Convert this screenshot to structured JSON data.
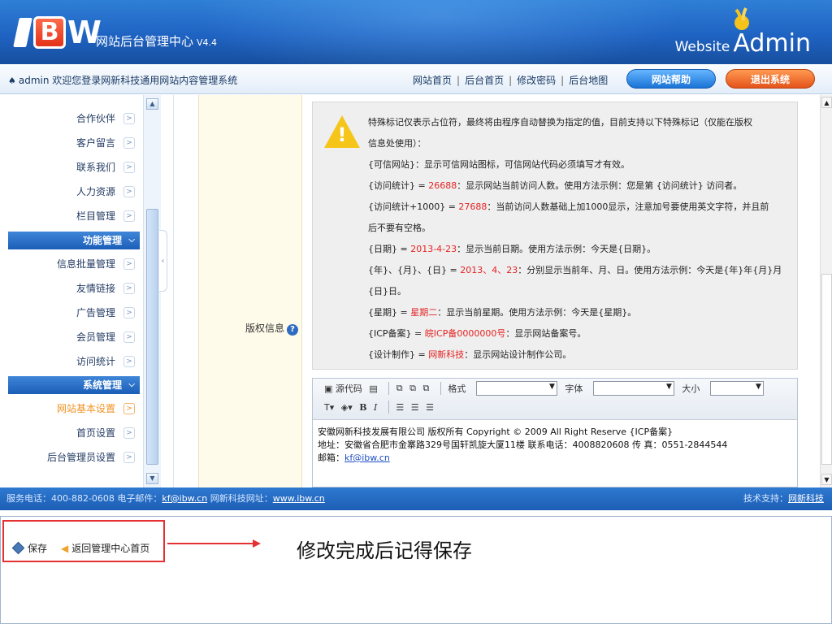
{
  "header": {
    "logo": "IBW",
    "title": "网站后台管理中心",
    "version": "V4.4",
    "brand_word1": "Website",
    "brand_word2": "Admin"
  },
  "topbar": {
    "welcome": "admin 欢迎您登录网新科技通用网站内容管理系统",
    "links": [
      "网站首页",
      "后台首页",
      "修改密码",
      "后台地图"
    ],
    "help_button": "网站帮助",
    "logout_button": "退出系统"
  },
  "sidebar": {
    "items": [
      {
        "label": "合作伙伴",
        "type": "item"
      },
      {
        "label": "客户留言",
        "type": "item"
      },
      {
        "label": "联系我们",
        "type": "item"
      },
      {
        "label": "人力资源",
        "type": "item"
      },
      {
        "label": "栏目管理",
        "type": "item"
      },
      {
        "label": "功能管理",
        "type": "header"
      },
      {
        "label": "信息批量管理",
        "type": "item"
      },
      {
        "label": "友情链接",
        "type": "item"
      },
      {
        "label": "广告管理",
        "type": "item"
      },
      {
        "label": "会员管理",
        "type": "item"
      },
      {
        "label": "访问统计",
        "type": "item"
      },
      {
        "label": "系统管理",
        "type": "header"
      },
      {
        "label": "网站基本设置",
        "type": "item",
        "active": true
      },
      {
        "label": "首页设置",
        "type": "item"
      },
      {
        "label": "后台管理员设置",
        "type": "item"
      }
    ]
  },
  "form": {
    "field_label": "版权信息",
    "notice_lines": [
      "特殊标记仅表示占位符，最终将由程序自动替换为指定的值，目前支持以下特殊标记（仅能在版权",
      "信息处使用）：",
      "{可信网站}：显示可信网站图标，可信网站代码必须填写才有效。",
      {
        "a": "{访问统计} = ",
        "red": "26688",
        "b": "：显示网站当前访问人数。使用方法示例：您是第 {访问统计} 访问者。"
      },
      {
        "a": "{访问统计+1000} = ",
        "red": "27688",
        "b": "：当前访问人数基础上加1000显示，注意加号要使用英文字符，并且前"
      },
      "后不要有空格。",
      {
        "a": "{日期} = ",
        "red": "2013-4-23",
        "b": "：显示当前日期。使用方法示例：今天是{日期}。"
      },
      {
        "a": "{年}、{月}、{日} = ",
        "red": "2013、4、23",
        "b": "：分别显示当前年、月、日。使用方法示例：今天是{年}年{月}月"
      },
      "{日}日。",
      {
        "a": "{星期} = ",
        "red": "星期二",
        "b": "：显示当前星期。使用方法示例：今天是{星期}。"
      },
      {
        "a": "{ICP备案} = ",
        "red": "皖ICP备0000000号",
        "b": "：显示网站备案号。"
      },
      {
        "a": "{设计制作} = ",
        "red": "网新科技",
        "b": "：显示网站设计制作公司。"
      }
    ],
    "editor": {
      "source_label": "源代码",
      "format_label": "格式",
      "font_label": "字体",
      "size_label": "大小",
      "bold": "B",
      "italic": "I",
      "content_line1": "安徽网新科技发展有限公司 版权所有  Copyright © 2009 All Right Reserve {ICP备案}",
      "content_line2": "地址：安徽省合肥市金寨路329号国轩凯旋大厦11楼     联系电话：4008820608  传  真：0551-2844544",
      "content_line3_prefix": "邮箱：",
      "content_email": "kf@ibw.cn"
    }
  },
  "footer": {
    "phone_label": "服务电话：400-882-0608 电子邮件：",
    "email": "kf@ibw.cn",
    "site_label": " 网新科技网址：",
    "site": "www.ibw.cn",
    "support_label": "技术支持：",
    "support_link": "网新科技"
  },
  "actions": {
    "save": "保存",
    "back": "返回管理中心首页",
    "callout": "修改完成后记得保存"
  },
  "colors": {
    "header_blue": "#1f63c2",
    "accent_orange": "#f09223",
    "highlight_red": "#e52222"
  }
}
